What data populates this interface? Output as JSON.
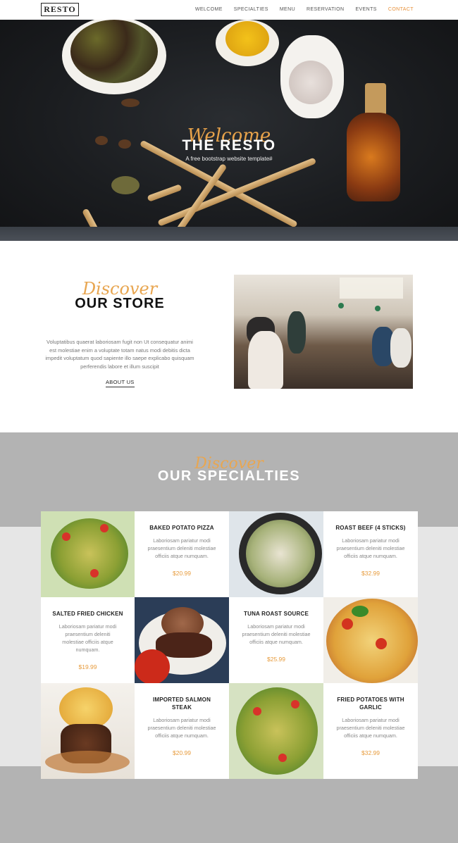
{
  "nav": {
    "logo": "RESTO",
    "items": [
      "WELCOME",
      "SPECIALTIES",
      "MENU",
      "RESERVATION",
      "EVENTS",
      "CONTACT"
    ],
    "active_index": 5,
    "accent": "#e8913a"
  },
  "hero": {
    "script": "Welcome",
    "title": "THE RESTO",
    "subtitle": "A free bootstrap website template#",
    "slides": 3,
    "active_slide": 0
  },
  "about": {
    "script": "Discover",
    "title": "OUR STORE",
    "text": "Voluptatibus quaerat laboriosam fugit non Ut consequatur animi est molestiae enim a voluptate totam natus modi debitis dicta impedit voluptatum quod sapiente illo saepe explicabo quisquam perferendis labore et illum suscipit",
    "button": "ABOUT US"
  },
  "specialties": {
    "script": "Discover",
    "title": "OUR SPECIALTIES",
    "items": [
      {
        "name": "BAKED POTATO PIZZA",
        "desc": "Laboriosam pariatur modi praesentium deleniti molestiae officiis atque numquam.",
        "price": "$20.99"
      },
      {
        "name": "ROAST BEEF (4 STICKS)",
        "desc": "Laboriosam pariatur modi praesentium deleniti molestiae officiis atque numquam.",
        "price": "$32.99"
      },
      {
        "name": "SALTED FRIED CHICKEN",
        "desc": "Laboriosam pariatur modi praesentium deleniti molestiae officiis atque numquam.",
        "price": "$19.99"
      },
      {
        "name": "TUNA ROAST SOURCE",
        "desc": "Laboriosam pariatur modi praesentium deleniti molestiae officiis atque numquam.",
        "price": "$25.99"
      },
      {
        "name": "IMPORTED SALMON STEAK",
        "desc": "Laboriosam pariatur modi praesentium deleniti molestiae officiis atque numquam.",
        "price": "$20.99"
      },
      {
        "name": "FRIED POTATOES WITH GARLIC",
        "desc": "Laboriosam pariatur modi praesentium deleniti molestiae officiis atque numquam.",
        "price": "$32.99"
      }
    ]
  },
  "colors": {
    "accent": "#e8a651",
    "price": "#e79b3c",
    "band": "#b3b3b3"
  }
}
